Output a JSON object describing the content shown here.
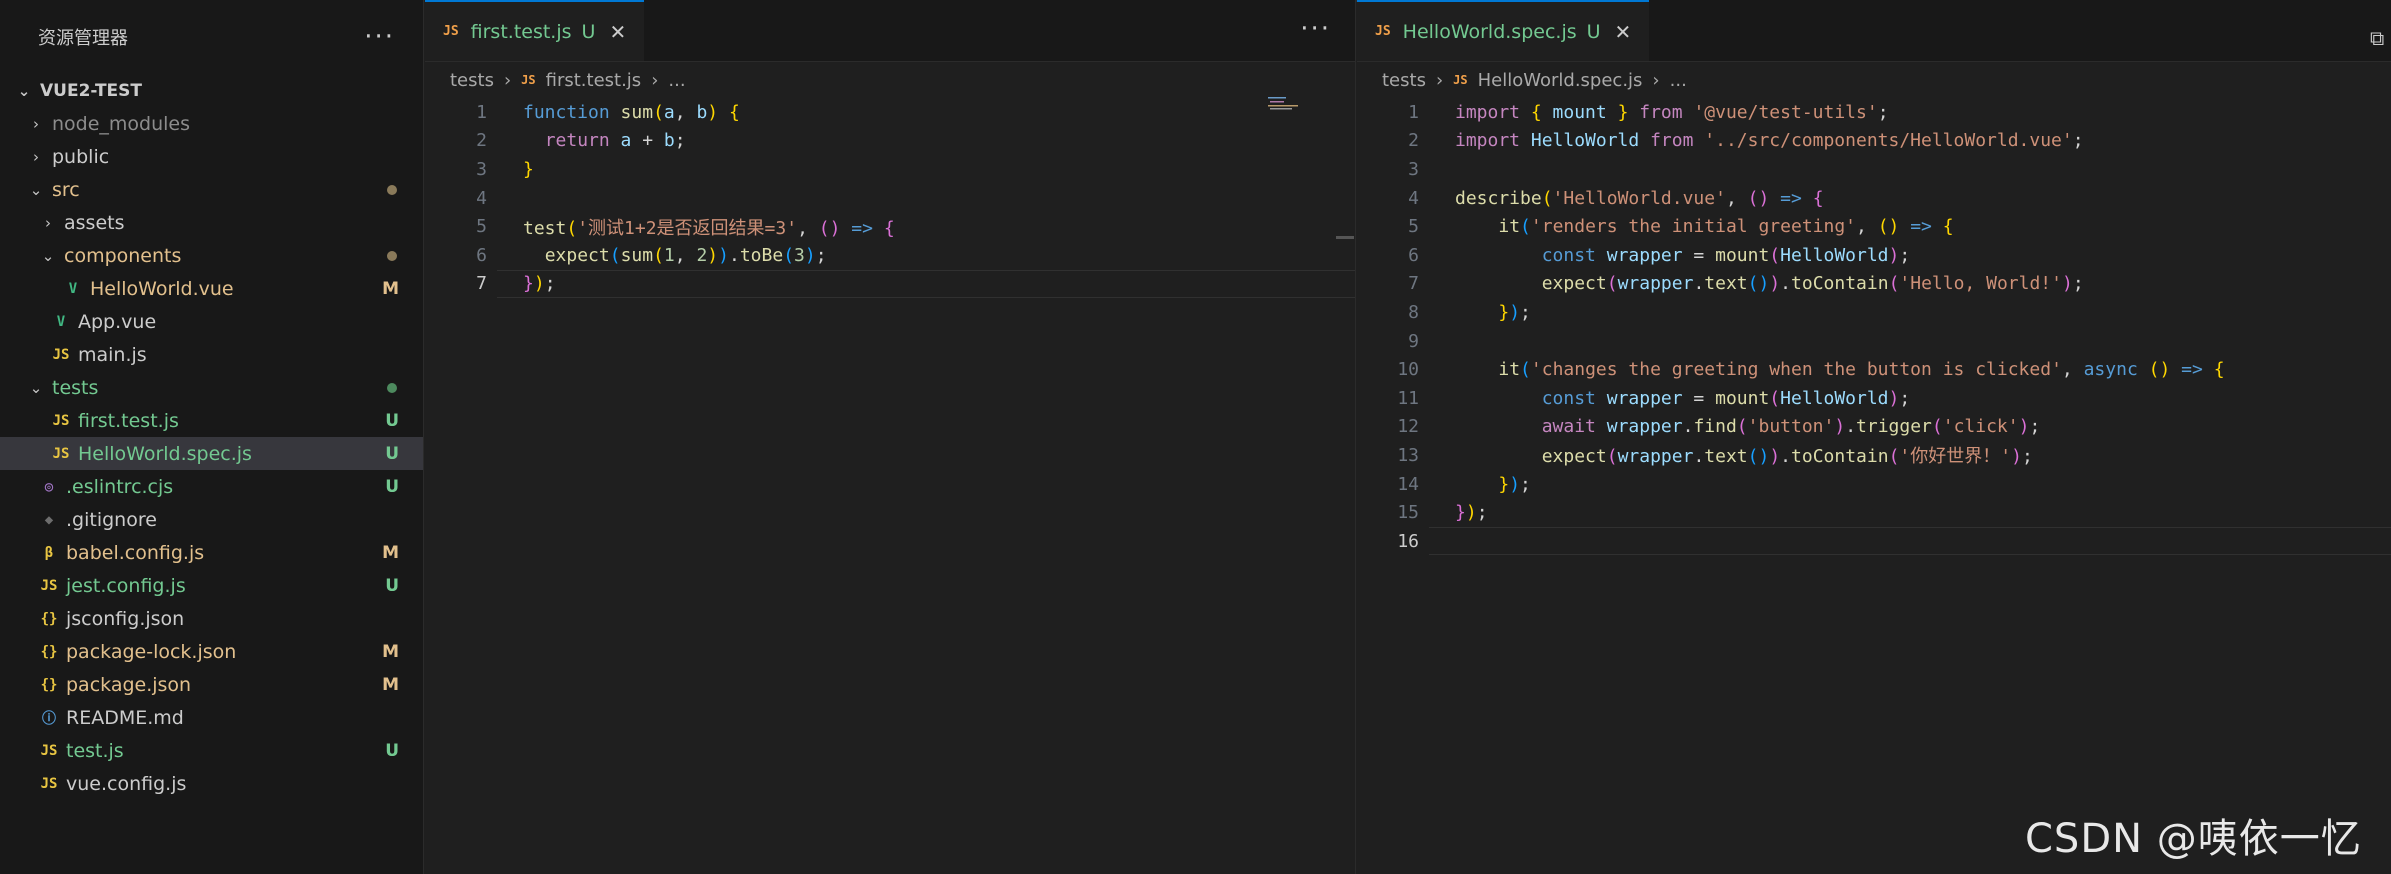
{
  "explorer": {
    "title": "资源管理器",
    "more_icon": "ellipsis-icon",
    "project": "VUE2-TEST",
    "items": [
      {
        "label": "node_modules",
        "type": "folder",
        "open": false,
        "depth": 1,
        "color": "#8c8c8c",
        "badge": ""
      },
      {
        "label": "public",
        "type": "folder",
        "open": false,
        "depth": 1,
        "color": "#cccccc",
        "badge": ""
      },
      {
        "label": "src",
        "type": "folder",
        "open": true,
        "depth": 1,
        "color": "#e2c08d",
        "badge": "dot"
      },
      {
        "label": "assets",
        "type": "folder",
        "open": false,
        "depth": 2,
        "color": "#cccccc",
        "badge": ""
      },
      {
        "label": "components",
        "type": "folder",
        "open": true,
        "depth": 2,
        "color": "#e2c08d",
        "badge": "dot"
      },
      {
        "label": "HelloWorld.vue",
        "type": "vue",
        "depth": 3,
        "color": "#e2c08d",
        "badge": "M"
      },
      {
        "label": "App.vue",
        "type": "vue",
        "depth": 2,
        "color": "#cccccc",
        "badge": ""
      },
      {
        "label": "main.js",
        "type": "js",
        "depth": 2,
        "color": "#cccccc",
        "badge": ""
      },
      {
        "label": "tests",
        "type": "folder",
        "open": true,
        "depth": 1,
        "color": "#73c991",
        "badge": "dot-green"
      },
      {
        "label": "first.test.js",
        "type": "js",
        "depth": 2,
        "color": "#73c991",
        "badge": "U"
      },
      {
        "label": "HelloWorld.spec.js",
        "type": "js",
        "depth": 2,
        "color": "#73c991",
        "badge": "U",
        "selected": true
      },
      {
        "label": ".eslintrc.cjs",
        "type": "eslint",
        "depth": 1,
        "color": "#73c991",
        "badge": "U"
      },
      {
        "label": ".gitignore",
        "type": "git",
        "depth": 1,
        "color": "#cccccc",
        "badge": ""
      },
      {
        "label": "babel.config.js",
        "type": "babel",
        "depth": 1,
        "color": "#e2c08d",
        "badge": "M"
      },
      {
        "label": "jest.config.js",
        "type": "js",
        "depth": 1,
        "color": "#73c991",
        "badge": "U"
      },
      {
        "label": "jsconfig.json",
        "type": "json",
        "depth": 1,
        "color": "#cccccc",
        "badge": ""
      },
      {
        "label": "package-lock.json",
        "type": "json",
        "depth": 1,
        "color": "#e2c08d",
        "badge": "M"
      },
      {
        "label": "package.json",
        "type": "json",
        "depth": 1,
        "color": "#e2c08d",
        "badge": "M"
      },
      {
        "label": "README.md",
        "type": "info",
        "depth": 1,
        "color": "#cccccc",
        "badge": ""
      },
      {
        "label": "test.js",
        "type": "js",
        "depth": 1,
        "color": "#73c991",
        "badge": "U"
      },
      {
        "label": "vue.config.js",
        "type": "js",
        "depth": 1,
        "color": "#cccccc",
        "badge": ""
      }
    ]
  },
  "left_editor": {
    "tab": {
      "icon": "JS",
      "name": "first.test.js",
      "badge": "U",
      "close": "✕"
    },
    "more": "···",
    "breadcrumb": {
      "folder": "tests",
      "icon": "JS",
      "file": "first.test.js",
      "tail": "..."
    },
    "current_line": 7,
    "lines": [
      [
        [
          "kw",
          "function "
        ],
        [
          "fn",
          "sum"
        ],
        [
          "p1",
          "("
        ],
        [
          "var",
          "a"
        ],
        [
          "plain",
          ", "
        ],
        [
          "var",
          "b"
        ],
        [
          "p1",
          ")"
        ],
        [
          "plain",
          " "
        ],
        [
          "p1",
          "{"
        ]
      ],
      [
        [
          "plain",
          "  "
        ],
        [
          "ctl",
          "return "
        ],
        [
          "var",
          "a"
        ],
        [
          "plain",
          " + "
        ],
        [
          "var",
          "b"
        ],
        [
          "plain",
          ";"
        ]
      ],
      [
        [
          "p1",
          "}"
        ]
      ],
      [],
      [
        [
          "fn",
          "test"
        ],
        [
          "p1",
          "("
        ],
        [
          "str",
          "'测试1+2是否返回结果=3'"
        ],
        [
          "plain",
          ", "
        ],
        [
          "p2",
          "()"
        ],
        [
          "plain",
          " "
        ],
        [
          "kw",
          "=>"
        ],
        [
          "plain",
          " "
        ],
        [
          "p2",
          "{"
        ]
      ],
      [
        [
          "plain",
          "  "
        ],
        [
          "fn",
          "expect"
        ],
        [
          "p3",
          "("
        ],
        [
          "fn",
          "sum"
        ],
        [
          "p1",
          "("
        ],
        [
          "num",
          "1"
        ],
        [
          "plain",
          ", "
        ],
        [
          "num",
          "2"
        ],
        [
          "p1",
          ")"
        ],
        [
          "p3",
          ")"
        ],
        [
          "plain",
          "."
        ],
        [
          "fn",
          "toBe"
        ],
        [
          "p3",
          "("
        ],
        [
          "num",
          "3"
        ],
        [
          "p3",
          ")"
        ],
        [
          "plain",
          ";"
        ]
      ],
      [
        [
          "p2",
          "}"
        ],
        [
          "p1",
          ")"
        ],
        [
          "plain",
          ";"
        ]
      ]
    ]
  },
  "right_editor": {
    "tab": {
      "icon": "JS",
      "name": "HelloWorld.spec.js",
      "badge": "U",
      "close": "✕"
    },
    "breadcrumb": {
      "folder": "tests",
      "icon": "JS",
      "file": "HelloWorld.spec.js",
      "tail": "..."
    },
    "current_line": 16,
    "lines": [
      [
        [
          "ctl",
          "import "
        ],
        [
          "p1",
          "{ "
        ],
        [
          "var",
          "mount"
        ],
        [
          "p1",
          " }"
        ],
        [
          "ctl",
          " from "
        ],
        [
          "str",
          "'@vue/test-utils'"
        ],
        [
          "plain",
          ";"
        ]
      ],
      [
        [
          "ctl",
          "import "
        ],
        [
          "var",
          "HelloWorld"
        ],
        [
          "ctl",
          " from "
        ],
        [
          "str",
          "'../src/components/HelloWorld.vue'"
        ],
        [
          "plain",
          ";"
        ]
      ],
      [],
      [
        [
          "fn",
          "describe"
        ],
        [
          "p1",
          "("
        ],
        [
          "str",
          "'HelloWorld.vue'"
        ],
        [
          "plain",
          ", "
        ],
        [
          "p2",
          "()"
        ],
        [
          "plain",
          " "
        ],
        [
          "kw",
          "=>"
        ],
        [
          "plain",
          " "
        ],
        [
          "p2",
          "{"
        ]
      ],
      [
        [
          "plain",
          "    "
        ],
        [
          "fn",
          "it"
        ],
        [
          "p3",
          "("
        ],
        [
          "str",
          "'renders the initial greeting'"
        ],
        [
          "plain",
          ", "
        ],
        [
          "p1",
          "()"
        ],
        [
          "plain",
          " "
        ],
        [
          "kw",
          "=>"
        ],
        [
          "plain",
          " "
        ],
        [
          "p1",
          "{"
        ]
      ],
      [
        [
          "plain",
          "        "
        ],
        [
          "kw",
          "const "
        ],
        [
          "var",
          "wrapper"
        ],
        [
          "plain",
          " = "
        ],
        [
          "fn",
          "mount"
        ],
        [
          "p2",
          "("
        ],
        [
          "var",
          "HelloWorld"
        ],
        [
          "p2",
          ")"
        ],
        [
          "plain",
          ";"
        ]
      ],
      [
        [
          "plain",
          "        "
        ],
        [
          "fn",
          "expect"
        ],
        [
          "p2",
          "("
        ],
        [
          "var",
          "wrapper"
        ],
        [
          "plain",
          "."
        ],
        [
          "fn",
          "text"
        ],
        [
          "p3",
          "()"
        ],
        [
          "p2",
          ")"
        ],
        [
          "plain",
          "."
        ],
        [
          "fn",
          "toContain"
        ],
        [
          "p2",
          "("
        ],
        [
          "str",
          "'Hello, World!'"
        ],
        [
          "p2",
          ")"
        ],
        [
          "plain",
          ";"
        ]
      ],
      [
        [
          "plain",
          "    "
        ],
        [
          "p1",
          "}"
        ],
        [
          "p3",
          ")"
        ],
        [
          "plain",
          ";"
        ]
      ],
      [],
      [
        [
          "plain",
          "    "
        ],
        [
          "fn",
          "it"
        ],
        [
          "p3",
          "("
        ],
        [
          "str",
          "'changes the greeting when the button is clicked'"
        ],
        [
          "plain",
          ", "
        ],
        [
          "kw",
          "async "
        ],
        [
          "p1",
          "()"
        ],
        [
          "plain",
          " "
        ],
        [
          "kw",
          "=>"
        ],
        [
          "plain",
          " "
        ],
        [
          "p1",
          "{"
        ]
      ],
      [
        [
          "plain",
          "        "
        ],
        [
          "kw",
          "const "
        ],
        [
          "var",
          "wrapper"
        ],
        [
          "plain",
          " = "
        ],
        [
          "fn",
          "mount"
        ],
        [
          "p2",
          "("
        ],
        [
          "var",
          "HelloWorld"
        ],
        [
          "p2",
          ")"
        ],
        [
          "plain",
          ";"
        ]
      ],
      [
        [
          "plain",
          "        "
        ],
        [
          "ctl",
          "await "
        ],
        [
          "var",
          "wrapper"
        ],
        [
          "plain",
          "."
        ],
        [
          "fn",
          "find"
        ],
        [
          "p2",
          "("
        ],
        [
          "str",
          "'button'"
        ],
        [
          "p2",
          ")"
        ],
        [
          "plain",
          "."
        ],
        [
          "fn",
          "trigger"
        ],
        [
          "p2",
          "("
        ],
        [
          "str",
          "'click'"
        ],
        [
          "p2",
          ")"
        ],
        [
          "plain",
          ";"
        ]
      ],
      [
        [
          "plain",
          "        "
        ],
        [
          "fn",
          "expect"
        ],
        [
          "p2",
          "("
        ],
        [
          "var",
          "wrapper"
        ],
        [
          "plain",
          "."
        ],
        [
          "fn",
          "text"
        ],
        [
          "p3",
          "()"
        ],
        [
          "p2",
          ")"
        ],
        [
          "plain",
          "."
        ],
        [
          "fn",
          "toContain"
        ],
        [
          "p2",
          "("
        ],
        [
          "str",
          "'你好世界！'"
        ],
        [
          "p2",
          ")"
        ],
        [
          "plain",
          ";"
        ]
      ],
      [
        [
          "plain",
          "    "
        ],
        [
          "p1",
          "}"
        ],
        [
          "p3",
          ")"
        ],
        [
          "plain",
          ";"
        ]
      ],
      [
        [
          "p2",
          "}"
        ],
        [
          "p1",
          ")"
        ],
        [
          "plain",
          ";"
        ]
      ],
      []
    ]
  },
  "watermark": "CSDN @咦依一忆",
  "colors": {
    "accent": "#0078d4",
    "untracked": "#73c991",
    "modified": "#e2c08d"
  }
}
